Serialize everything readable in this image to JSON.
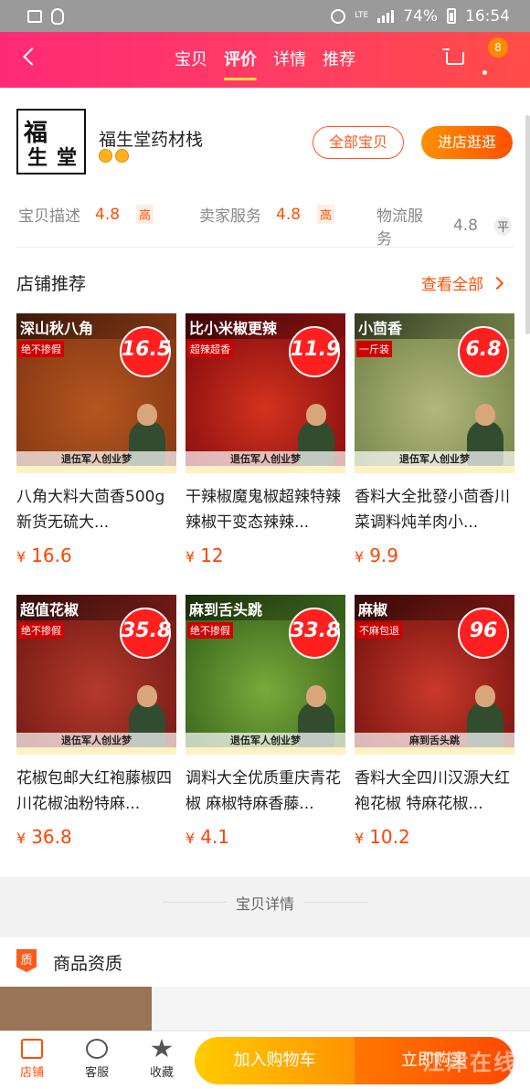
{
  "status_bar": {
    "lte": "LTE",
    "battery": "74%",
    "time": "16:54"
  },
  "nav": {
    "tabs": [
      "宝贝",
      "评价",
      "详情",
      "推荐"
    ],
    "active_tab": 1,
    "badge": "8"
  },
  "shop": {
    "logo_chars": [
      "福",
      "生",
      "堂"
    ],
    "name": "福生堂药材栈",
    "all_button": "全部宝贝",
    "visit_button": "进店逛逛",
    "ratings": [
      {
        "label": "宝贝描述",
        "score": "4.8",
        "level": "高"
      },
      {
        "label": "卖家服务",
        "score": "4.8",
        "level": "高"
      },
      {
        "label": "物流服务",
        "score": "4.8",
        "level": "平"
      }
    ]
  },
  "recommend": {
    "heading": "店铺推荐",
    "see_all": "查看全部",
    "currency": "¥",
    "products": [
      {
        "banner": "深山秋八角",
        "tag": "绝不掺假",
        "flag": "16.5",
        "dream": "退伍军人创业梦",
        "title": "八角大料大茴香500g新货无硫大...",
        "price": "16.6",
        "colors": [
          "#8a3a15",
          "#b5561f"
        ]
      },
      {
        "banner": "比小米椒更辣",
        "tag": "超辣超香",
        "flag": "11.9",
        "dream": "退伍军人创业梦",
        "title": "干辣椒魔鬼椒超辣特辣辣椒干变态辣辣...",
        "price": "12",
        "colors": [
          "#8e1010",
          "#d2331f"
        ]
      },
      {
        "banner": "小茴香",
        "tag": "一斤装",
        "flag": "6.8",
        "dream": "退伍军人创业梦",
        "title": "香料大全批發小茴香川菜调料炖羊肉小...",
        "price": "9.9",
        "colors": [
          "#7b8a4e",
          "#b3b77d"
        ]
      },
      {
        "banner": "超值花椒",
        "tag": "绝不掺假",
        "flag": "35.8",
        "dream": "退伍军人创业梦",
        "title": "花椒包邮大红袍藤椒四川花椒油粉特麻...",
        "price": "36.8",
        "colors": [
          "#7a1d18",
          "#b43a2a"
        ]
      },
      {
        "banner": "麻到舌头跳",
        "tag": "绝不掺假",
        "flag": "33.8",
        "dream": "退伍军人创业梦",
        "title": "调料大全优质重庆青花椒 麻椒特麻香藤...",
        "price": "4.1",
        "colors": [
          "#3d6a1e",
          "#7aa93b"
        ]
      },
      {
        "banner": "麻椒",
        "tag": "不麻包退",
        "flag": "96",
        "dream": "麻到舌头跳",
        "title": "香料大全四川汉源大红袍花椒 特麻花椒...",
        "price": "10.2",
        "colors": [
          "#7e1712",
          "#c9392b"
        ]
      }
    ]
  },
  "details_label": "宝贝详情",
  "qualification": {
    "icon_text": "质",
    "title": "商品资质"
  },
  "bottom_bar": {
    "shop": "店铺",
    "service": "客服",
    "favorite": "收藏",
    "add_cart": "加入购物车",
    "buy_now": "立即购买",
    "watermark": "江津在线"
  }
}
